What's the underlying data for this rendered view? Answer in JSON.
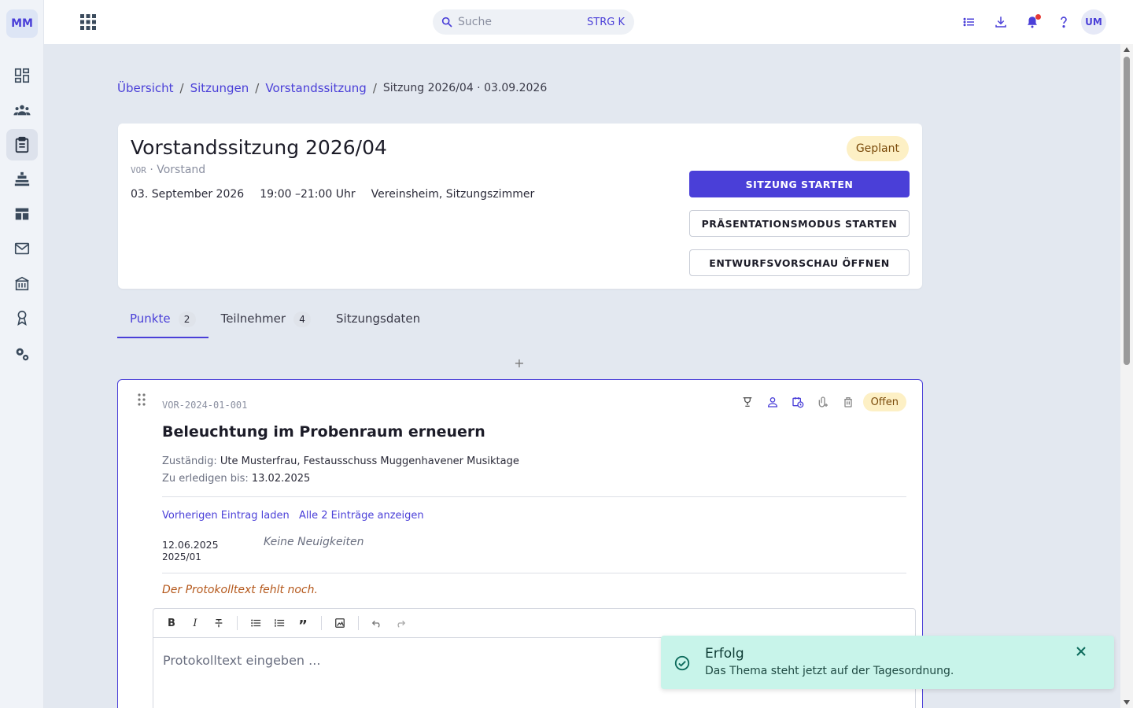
{
  "sidebar": {
    "logo": "MM",
    "items": [
      {
        "icon": "dashboard-icon"
      },
      {
        "icon": "members-icon"
      },
      {
        "icon": "meetings-icon"
      },
      {
        "icon": "events-icon"
      },
      {
        "icon": "tables-icon"
      },
      {
        "icon": "mail-icon"
      },
      {
        "icon": "institution-icon"
      },
      {
        "icon": "awards-icon"
      },
      {
        "icon": "settings-icon"
      }
    ]
  },
  "topbar": {
    "search_placeholder": "Suche",
    "search_shortcut": "STRG K",
    "avatar": "UM"
  },
  "breadcrumb": {
    "items": [
      "Übersicht",
      "Sitzungen",
      "Vorstandssitzung"
    ],
    "current": "Sitzung 2026/04 · 03.09.2026"
  },
  "meeting": {
    "title": "Vorstandssitzung 2026/04",
    "code": "VOR",
    "group": " · Vorstand",
    "date": "03. September 2026",
    "time": "19:00 –21:00 Uhr",
    "location": "Vereinsheim, Sitzungszimmer",
    "status": "Geplant",
    "buttons": {
      "start": "SITZUNG STARTEN",
      "present": "PRÄSENTATIONSMODUS STARTEN",
      "preview": "ENTWURFSVORSCHAU ÖFFNEN"
    }
  },
  "tabs": [
    {
      "label": "Punkte",
      "count": "2"
    },
    {
      "label": "Teilnehmer",
      "count": "4"
    },
    {
      "label": "Sitzungsdaten",
      "count": ""
    }
  ],
  "add_label": "+",
  "item": {
    "code": "VOR-2024-01-001",
    "title": "Beleuchtung im Probenraum erneuern",
    "responsible_label": "Zuständig: ",
    "responsible": "Ute Musterfrau, Festausschuss Muggenhavener Musiktage",
    "due_label": "Zu erledigen bis: ",
    "due": "13.02.2025",
    "status": "Offen",
    "links": {
      "previous": "Vorherigen Eintrag laden",
      "all": "Alle 2 Einträge anzeigen"
    },
    "history": {
      "date": "12.06.2025",
      "ref": "2025/01",
      "text": "Keine Neuigkeiten"
    },
    "missing_protocol": "Der Protokolltext fehlt noch.",
    "editor": {
      "placeholder": "Protokolltext eingeben ...",
      "bold": "B",
      "italic": "I",
      "quote": "”"
    }
  },
  "toast": {
    "title": "Erfolg",
    "message": "Das Thema steht jetzt auf der Tagesordnung."
  },
  "colors": {
    "accent": "#4a3fd8",
    "background": "#e3e8f0",
    "badge_bg": "#fdf0c5",
    "toast_bg": "#c8f4ea",
    "warning_text": "#b4571a"
  }
}
